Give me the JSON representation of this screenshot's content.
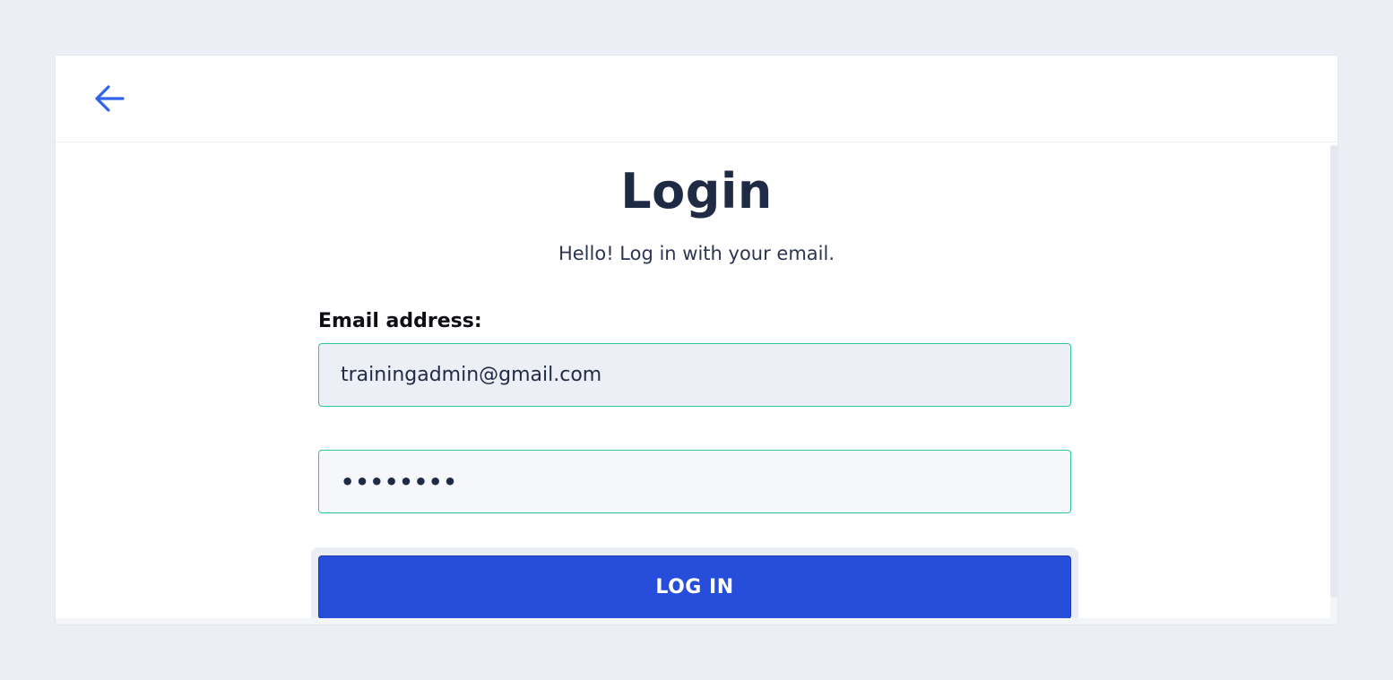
{
  "header": {
    "back_icon": "arrow-left-icon"
  },
  "login": {
    "title": "Login",
    "subtitle": "Hello! Log in with your email.",
    "email_label": "Email address:",
    "email_value": "trainingadmin@gmail.com",
    "password_value": "••••••••",
    "button_label": "LOG IN"
  },
  "colors": {
    "accent": "#274ddb",
    "field_border": "#2fc79a",
    "title": "#1f2a44",
    "background": "#ebeef5"
  }
}
